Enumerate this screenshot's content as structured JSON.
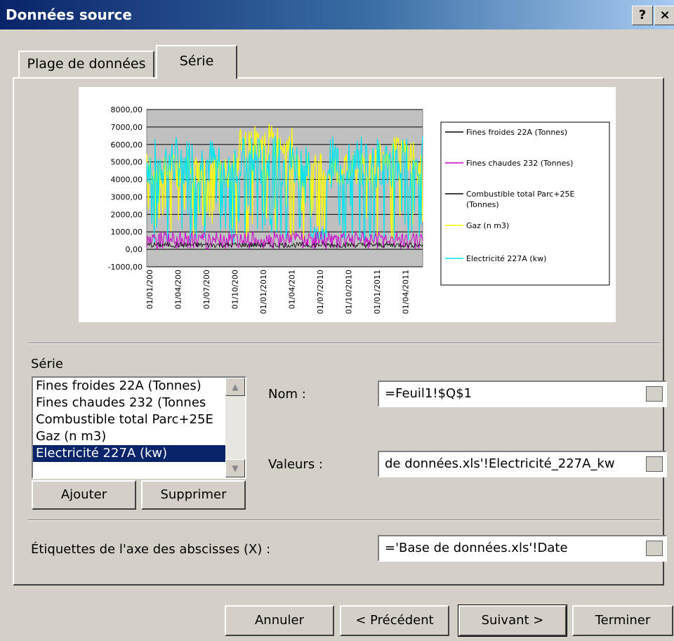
{
  "window": {
    "title": "Données source",
    "help_btn": "?",
    "close_btn": "×"
  },
  "tabs": [
    {
      "label": "Plage de données"
    },
    {
      "label": "Série"
    }
  ],
  "chart_data": {
    "type": "line",
    "yticks": [
      "8000,00",
      "7000,00",
      "6000,00",
      "5000,00",
      "4000,00",
      "3000,00",
      "2000,00",
      "1000,00",
      "0,00",
      "-1000,00"
    ],
    "ylim": [
      -1000,
      8000
    ],
    "xticks": [
      "01/01/200",
      "01/04/200",
      "01/07/200",
      "01/10/200",
      "01/01/2010",
      "01/04/201",
      "01/07/2010",
      "01/10/2010",
      "01/01/2011",
      "01/04/2011"
    ],
    "legend_position": "right",
    "series": [
      {
        "name": "Fines froides 22A (Tonnes)",
        "color": "#000000"
      },
      {
        "name": "Fines chaudes 232 (Tonnes)",
        "color": "#cc00cc"
      },
      {
        "name": "Combustible total Parc+25E (Tonnes)",
        "color": "#000000"
      },
      {
        "name": "Gaz (n m3)",
        "color": "#ffff00"
      },
      {
        "name": "Electricité 227A (kw)",
        "color": "#00e5ee"
      }
    ]
  },
  "serie_section": {
    "label": "Série",
    "list_items": [
      "Fines froides 22A (Tonnes)",
      "Fines chaudes 232 (Tonnes",
      "Combustible total Parc+25E",
      "Gaz (n m3)",
      "Electricité 227A (kw)"
    ],
    "selected_index": 4,
    "add_btn": "Ajouter",
    "remove_btn": "Supprimer"
  },
  "fields": {
    "nom_label": "Nom :",
    "nom_value": "=Feuil1!$Q$1",
    "valeurs_label": "Valeurs :",
    "valeurs_value": "de données.xls'!Electricité_227A_kw",
    "axis_label": "Étiquettes de l'axe des abscisses (X) :",
    "axis_value": "='Base de données.xls'!Date"
  },
  "footer": {
    "cancel": "Annuler",
    "prev": "< Précédent",
    "next": "Suivant >",
    "finish": "Terminer"
  }
}
